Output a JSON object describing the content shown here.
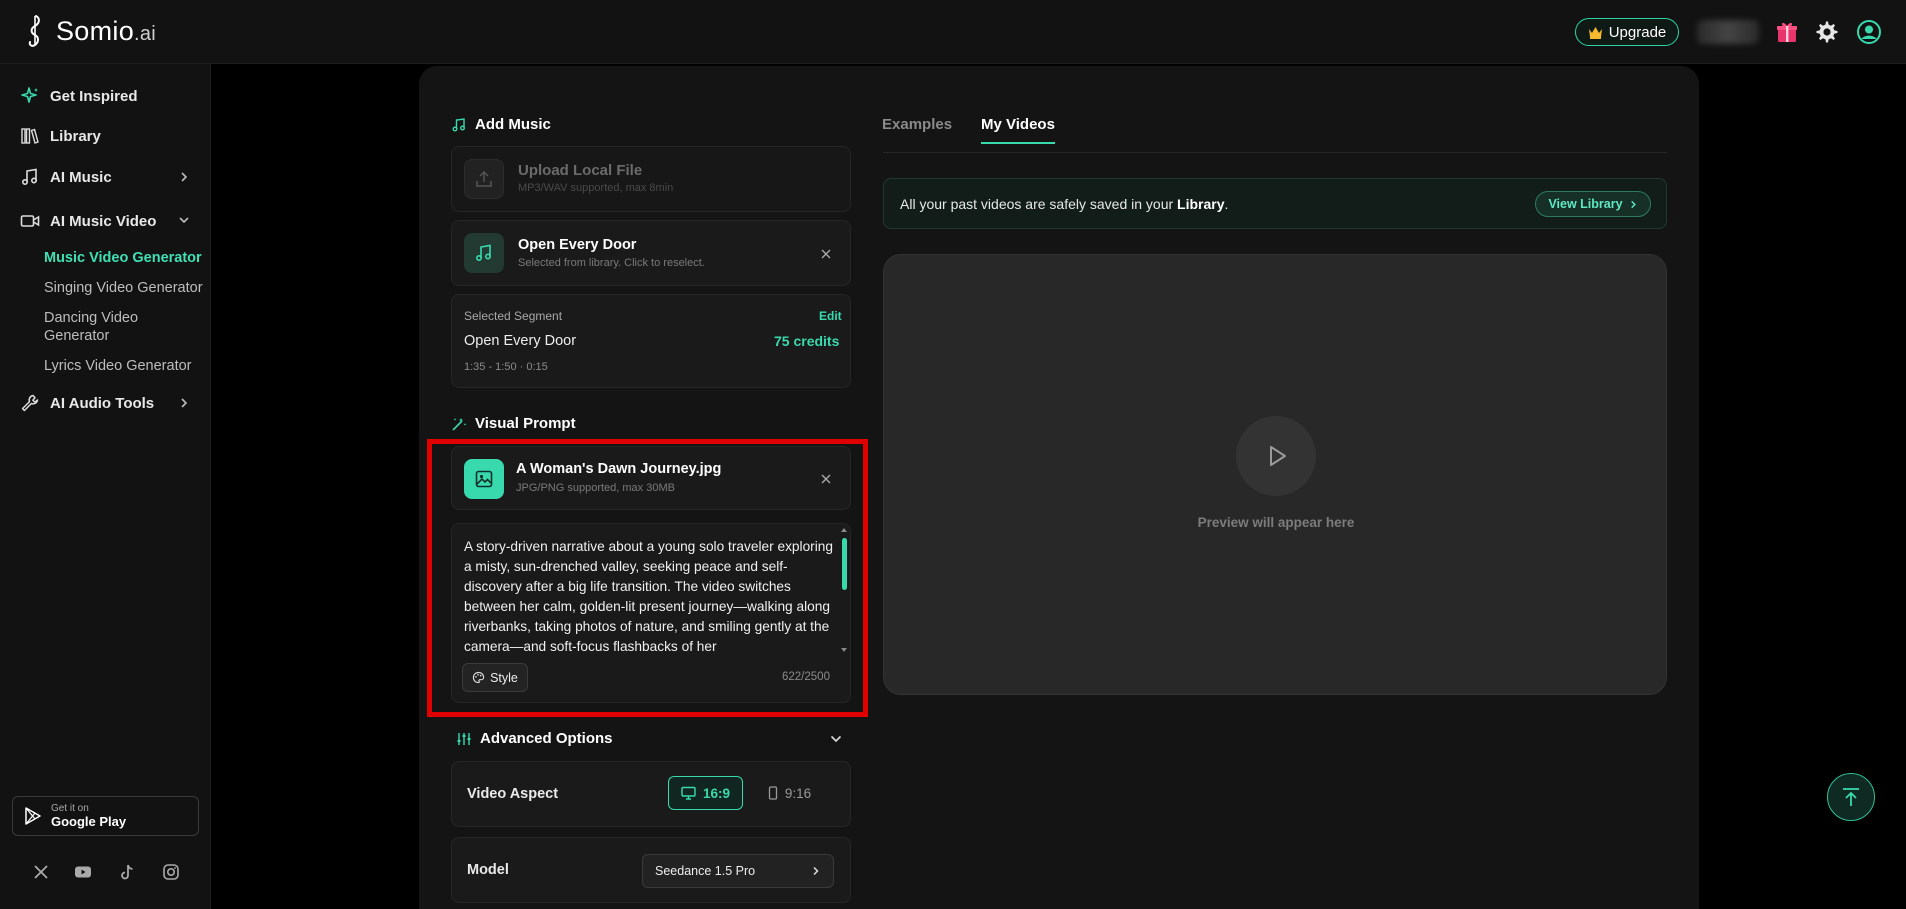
{
  "app": {
    "logo_name": "Somio",
    "logo_suffix": ".ai",
    "upgrade_label": "Upgrade"
  },
  "sidebar": {
    "items": [
      {
        "label": "Get Inspired",
        "icon": "sparkle-icon"
      },
      {
        "label": "Library",
        "icon": "library-icon"
      },
      {
        "label": "AI Music",
        "icon": "music-note-icon"
      },
      {
        "label": "AI Music Video",
        "icon": "video-camera-icon"
      },
      {
        "label": "AI Audio Tools",
        "icon": "wrench-icon"
      }
    ],
    "subitems": [
      {
        "label": "Music Video Generator",
        "active": true
      },
      {
        "label": "Singing Video Generator",
        "active": false
      },
      {
        "label": "Dancing Video Generator",
        "active": false
      },
      {
        "label": "Lyrics Video Generator",
        "active": false
      }
    ],
    "google_play": {
      "small": "Get it on",
      "big": "Google Play"
    }
  },
  "add_music": {
    "title": "Add Music",
    "upload_title": "Upload Local File",
    "upload_sub": "MP3/WAV supported, max 8min",
    "selected_title": "Open Every Door",
    "selected_sub": "Selected from library. Click to reselect."
  },
  "segment": {
    "label": "Selected Segment",
    "edit": "Edit",
    "song": "Open Every Door",
    "credits": "75 credits",
    "range": "1:35 - 1:50 · 0:15"
  },
  "visual_prompt": {
    "title": "Visual Prompt",
    "file_name": "A Woman's Dawn Journey.jpg",
    "file_sub": "JPG/PNG supported, max 30MB",
    "text": "A story-driven narrative about a young solo traveler exploring a misty, sun-drenched valley, seeking peace and self-discovery after a big life transition. The video switches between her calm, golden-lit present journey—walking along riverbanks, taking photos of nature, and smiling gently at the camera—and soft-focus flashbacks of her",
    "style_label": "Style",
    "char_count": "622/2500"
  },
  "advanced": {
    "title": "Advanced Options",
    "aspect_label": "Video Aspect",
    "aspect_options": [
      "16:9",
      "9:16"
    ],
    "model_label": "Model",
    "model_value": "Seedance 1.5 Pro"
  },
  "right": {
    "tabs": [
      "Examples",
      "My Videos"
    ],
    "active_tab": "My Videos",
    "notice_prefix": "All your past videos are safely saved in your ",
    "notice_bold": "Library",
    "notice_suffix": ".",
    "view_library": "View Library",
    "preview_text": "Preview will appear here"
  },
  "colors": {
    "accent": "#39d9ae",
    "highlight": "#e00000",
    "background": "#000000",
    "panel": "#141414"
  }
}
